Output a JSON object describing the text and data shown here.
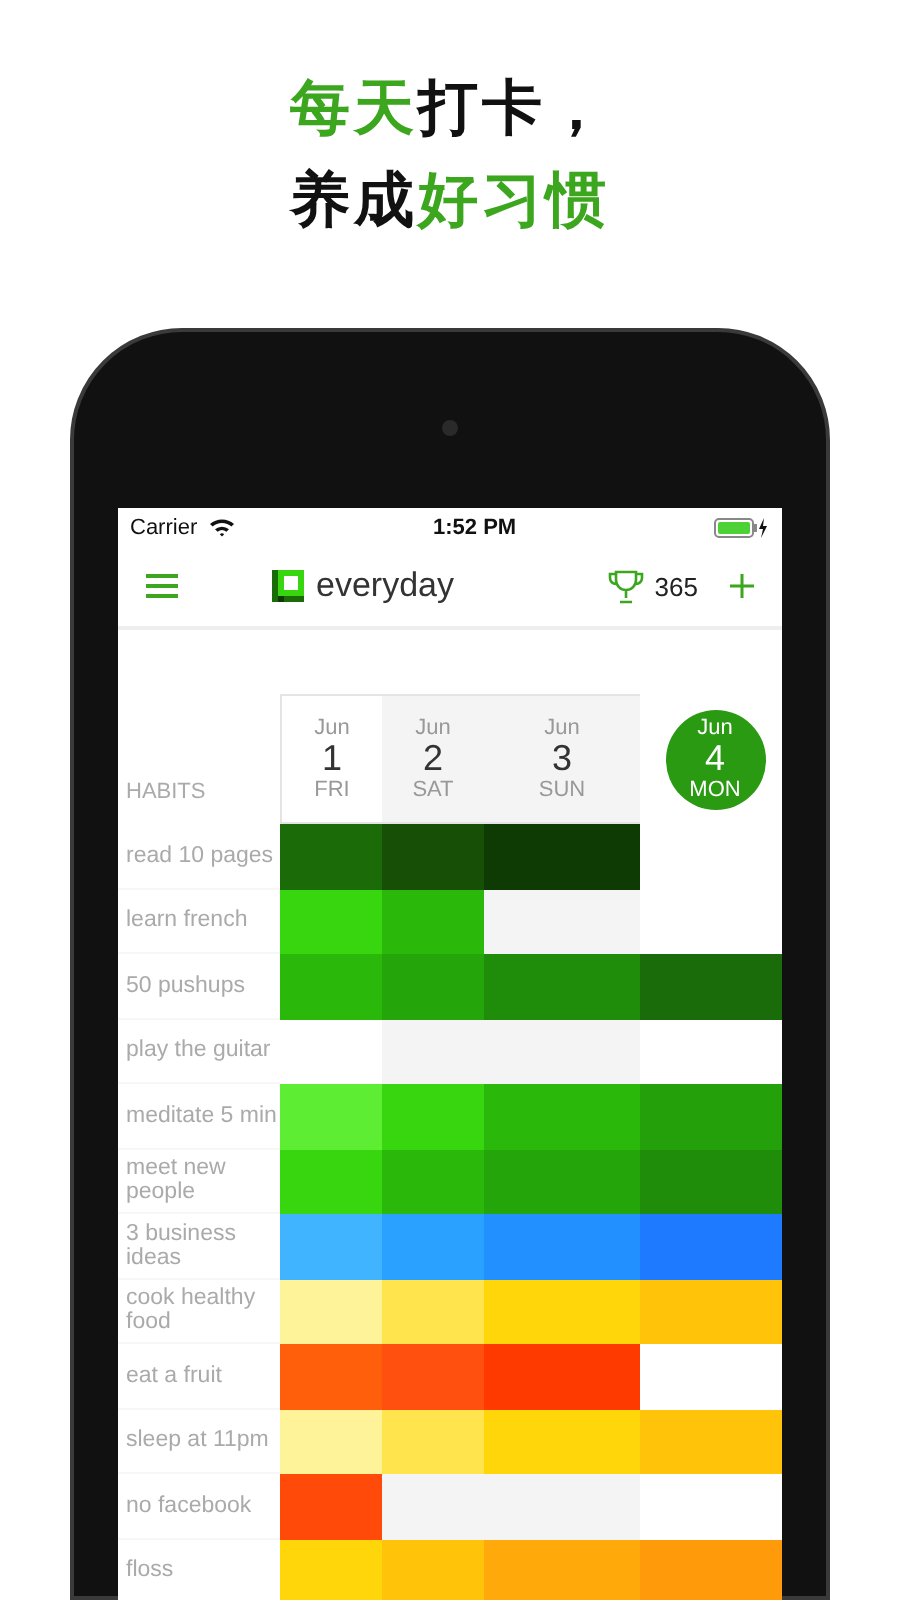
{
  "headline": [
    [
      {
        "text": "每天",
        "accent": true
      },
      {
        "text": "打卡，",
        "accent": false
      }
    ],
    [
      {
        "text": "养成",
        "accent": false
      },
      {
        "text": "好习惯",
        "accent": true
      }
    ]
  ],
  "status_bar": {
    "carrier": "Carrier",
    "time": "1:52 PM"
  },
  "nav": {
    "app_name": "everyday",
    "trophy_count": "365"
  },
  "habits_heading": "HABITS",
  "days": [
    {
      "month": "Jun",
      "day": "1",
      "weekday": "FRI",
      "weekend": false,
      "selected": false
    },
    {
      "month": "Jun",
      "day": "2",
      "weekday": "SAT",
      "weekend": true,
      "selected": false
    },
    {
      "month": "Jun",
      "day": "3",
      "weekday": "SUN",
      "weekend": true,
      "selected": false
    },
    {
      "month": "Jun",
      "day": "4",
      "weekday": "MON",
      "weekend": false,
      "selected": true
    }
  ],
  "habits": [
    {
      "name": "read 10 pages",
      "cells": [
        {
          "done": true,
          "color": "#1c6b09"
        },
        {
          "done": true,
          "color": "#174f06"
        },
        {
          "done": true,
          "color": "#0e3a03"
        },
        {
          "done": false
        }
      ]
    },
    {
      "name": "learn french",
      "cells": [
        {
          "done": true,
          "color": "#38d60f"
        },
        {
          "done": true,
          "color": "#2ab80a"
        },
        {
          "done": false
        },
        {
          "done": false
        }
      ]
    },
    {
      "name": "50 pushups",
      "cells": [
        {
          "done": true,
          "color": "#2ab80a"
        },
        {
          "done": true,
          "color": "#24a60a"
        },
        {
          "done": true,
          "color": "#1f8c0a"
        },
        {
          "done": true,
          "color": "#1a6b09"
        }
      ]
    },
    {
      "name": "play the guitar",
      "cells": [
        {
          "done": false
        },
        {
          "done": false
        },
        {
          "done": false
        },
        {
          "done": false
        }
      ]
    },
    {
      "name": "meditate 5 min",
      "cells": [
        {
          "done": true,
          "color": "#5ded32"
        },
        {
          "done": true,
          "color": "#38d60f"
        },
        {
          "done": true,
          "color": "#2ab80a"
        },
        {
          "done": true,
          "color": "#24a00a"
        }
      ]
    },
    {
      "name": "meet new people",
      "cells": [
        {
          "done": true,
          "color": "#38d60f"
        },
        {
          "done": true,
          "color": "#2ab80a"
        },
        {
          "done": true,
          "color": "#24a60a"
        },
        {
          "done": true,
          "color": "#1f8c0a"
        }
      ]
    },
    {
      "name": "3 business ideas",
      "cells": [
        {
          "done": true,
          "color": "#40b4ff"
        },
        {
          "done": true,
          "color": "#2aa0ff"
        },
        {
          "done": true,
          "color": "#2290ff"
        },
        {
          "done": true,
          "color": "#1e7bff"
        }
      ]
    },
    {
      "name": "cook healthy food",
      "cells": [
        {
          "done": true,
          "color": "#fff39a"
        },
        {
          "done": true,
          "color": "#ffe44d"
        },
        {
          "done": true,
          "color": "#ffd60a"
        },
        {
          "done": true,
          "color": "#ffc40a"
        }
      ]
    },
    {
      "name": "eat a fruit",
      "cells": [
        {
          "done": true,
          "color": "#ff5e0a"
        },
        {
          "done": true,
          "color": "#ff5010"
        },
        {
          "done": true,
          "color": "#ff3a00"
        },
        {
          "done": false
        }
      ]
    },
    {
      "name": "sleep at 11pm",
      "cells": [
        {
          "done": true,
          "color": "#fff39a"
        },
        {
          "done": true,
          "color": "#ffe44d"
        },
        {
          "done": true,
          "color": "#ffd60a"
        },
        {
          "done": true,
          "color": "#ffc40a"
        }
      ]
    },
    {
      "name": "no facebook",
      "cells": [
        {
          "done": true,
          "color": "#ff4a0a"
        },
        {
          "done": false
        },
        {
          "done": false
        },
        {
          "done": false
        }
      ]
    },
    {
      "name": "floss",
      "cells": [
        {
          "done": true,
          "color": "#ffd60a"
        },
        {
          "done": true,
          "color": "#ffc40a"
        },
        {
          "done": true,
          "color": "#ffaa0a"
        },
        {
          "done": true,
          "color": "#ff9a0a"
        }
      ]
    }
  ]
}
